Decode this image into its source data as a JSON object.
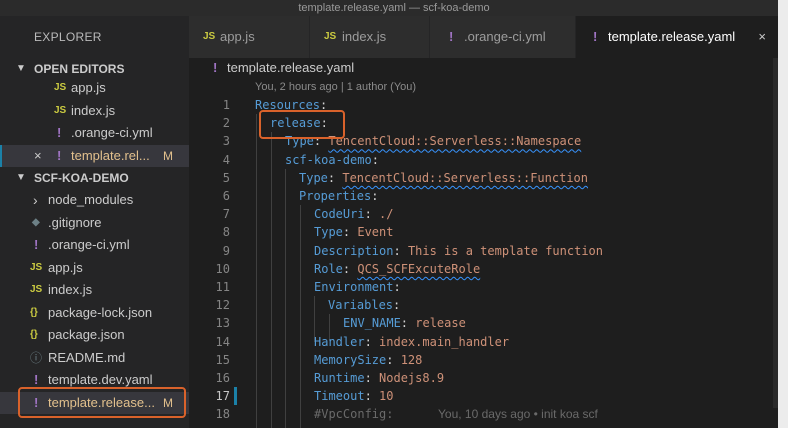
{
  "window_title": "template.release.yaml — scf-koa-demo",
  "sidebar": {
    "title": "EXPLORER",
    "open_editors": {
      "header": "OPEN EDITORS",
      "items": [
        {
          "icon": "JS",
          "label": "app.js"
        },
        {
          "icon": "JS",
          "label": "index.js"
        },
        {
          "icon": "!",
          "label": ".orange-ci.yml"
        },
        {
          "icon": "!",
          "label": "template.rel...",
          "badge": "M",
          "close": "×"
        }
      ]
    },
    "project": {
      "header": "SCF-KOA-DEMO",
      "items": [
        {
          "icon": "›",
          "label": "node_modules"
        },
        {
          "icon": "◆",
          "label": ".gitignore"
        },
        {
          "icon": "!",
          "label": ".orange-ci.yml"
        },
        {
          "icon": "JS",
          "label": "app.js"
        },
        {
          "icon": "JS",
          "label": "index.js"
        },
        {
          "icon": "{}",
          "label": "package-lock.json"
        },
        {
          "icon": "{}",
          "label": "package.json"
        },
        {
          "icon": "ⓘ",
          "label": "README.md"
        },
        {
          "icon": "!",
          "label": "template.dev.yaml"
        },
        {
          "icon": "!",
          "label": "template.release...",
          "badge": "M"
        }
      ]
    }
  },
  "tabs": [
    {
      "icon": "JS",
      "label": "app.js"
    },
    {
      "icon": "JS",
      "label": "index.js"
    },
    {
      "icon": "!",
      "label": ".orange-ci.yml"
    },
    {
      "icon": "!",
      "label": "template.release.yaml",
      "close": "×"
    }
  ],
  "breadcrumb": {
    "icon": "!",
    "label": "template.release.yaml"
  },
  "blame": "You, 2 hours ago | 1 author (You)",
  "code": {
    "line_numbers": [
      "1",
      "2",
      "3",
      "4",
      "5",
      "6",
      "7",
      "8",
      "9",
      "10",
      "11",
      "12",
      "13",
      "14",
      "15",
      "16",
      "17",
      "18"
    ],
    "lines": [
      {
        "key": "Resources",
        "sep": ":",
        "val": ""
      },
      {
        "key": "release",
        "sep": ":",
        "val": ""
      },
      {
        "key": "Type",
        "sep": ": ",
        "val": "TencentCloud::Serverless::Namespace"
      },
      {
        "key": "scf-koa-demo",
        "sep": ":",
        "val": ""
      },
      {
        "key": "Type",
        "sep": ": ",
        "val": "TencentCloud::Serverless::Function"
      },
      {
        "key": "Properties",
        "sep": ":",
        "val": ""
      },
      {
        "key": "CodeUri",
        "sep": ": ",
        "val": "./"
      },
      {
        "key": "Type",
        "sep": ": ",
        "val": "Event"
      },
      {
        "key": "Description",
        "sep": ": ",
        "val": "This is a template function"
      },
      {
        "key": "Role",
        "sep": ": ",
        "val": "QCS_SCFExcuteRole"
      },
      {
        "key": "Environment",
        "sep": ":",
        "val": ""
      },
      {
        "key": "Variables",
        "sep": ":",
        "val": ""
      },
      {
        "key": "ENV_NAME",
        "sep": ": ",
        "val": "release"
      },
      {
        "key": "Handler",
        "sep": ": ",
        "val": "index.main_handler"
      },
      {
        "key": "MemorySize",
        "sep": ": ",
        "val": "128"
      },
      {
        "key": "Runtime",
        "sep": ": ",
        "val": "Nodejs8.9"
      },
      {
        "key": "Timeout",
        "sep": ": ",
        "val": "10"
      },
      {
        "key": "#VpcConfig",
        "sep": ":",
        "val": ""
      }
    ],
    "inline_blame": "You, 10 days ago • init koa scf"
  },
  "colors": {
    "accent_highlight": "#d9622b",
    "yaml_key": "#569cd6",
    "yaml_value": "#ce9178"
  }
}
